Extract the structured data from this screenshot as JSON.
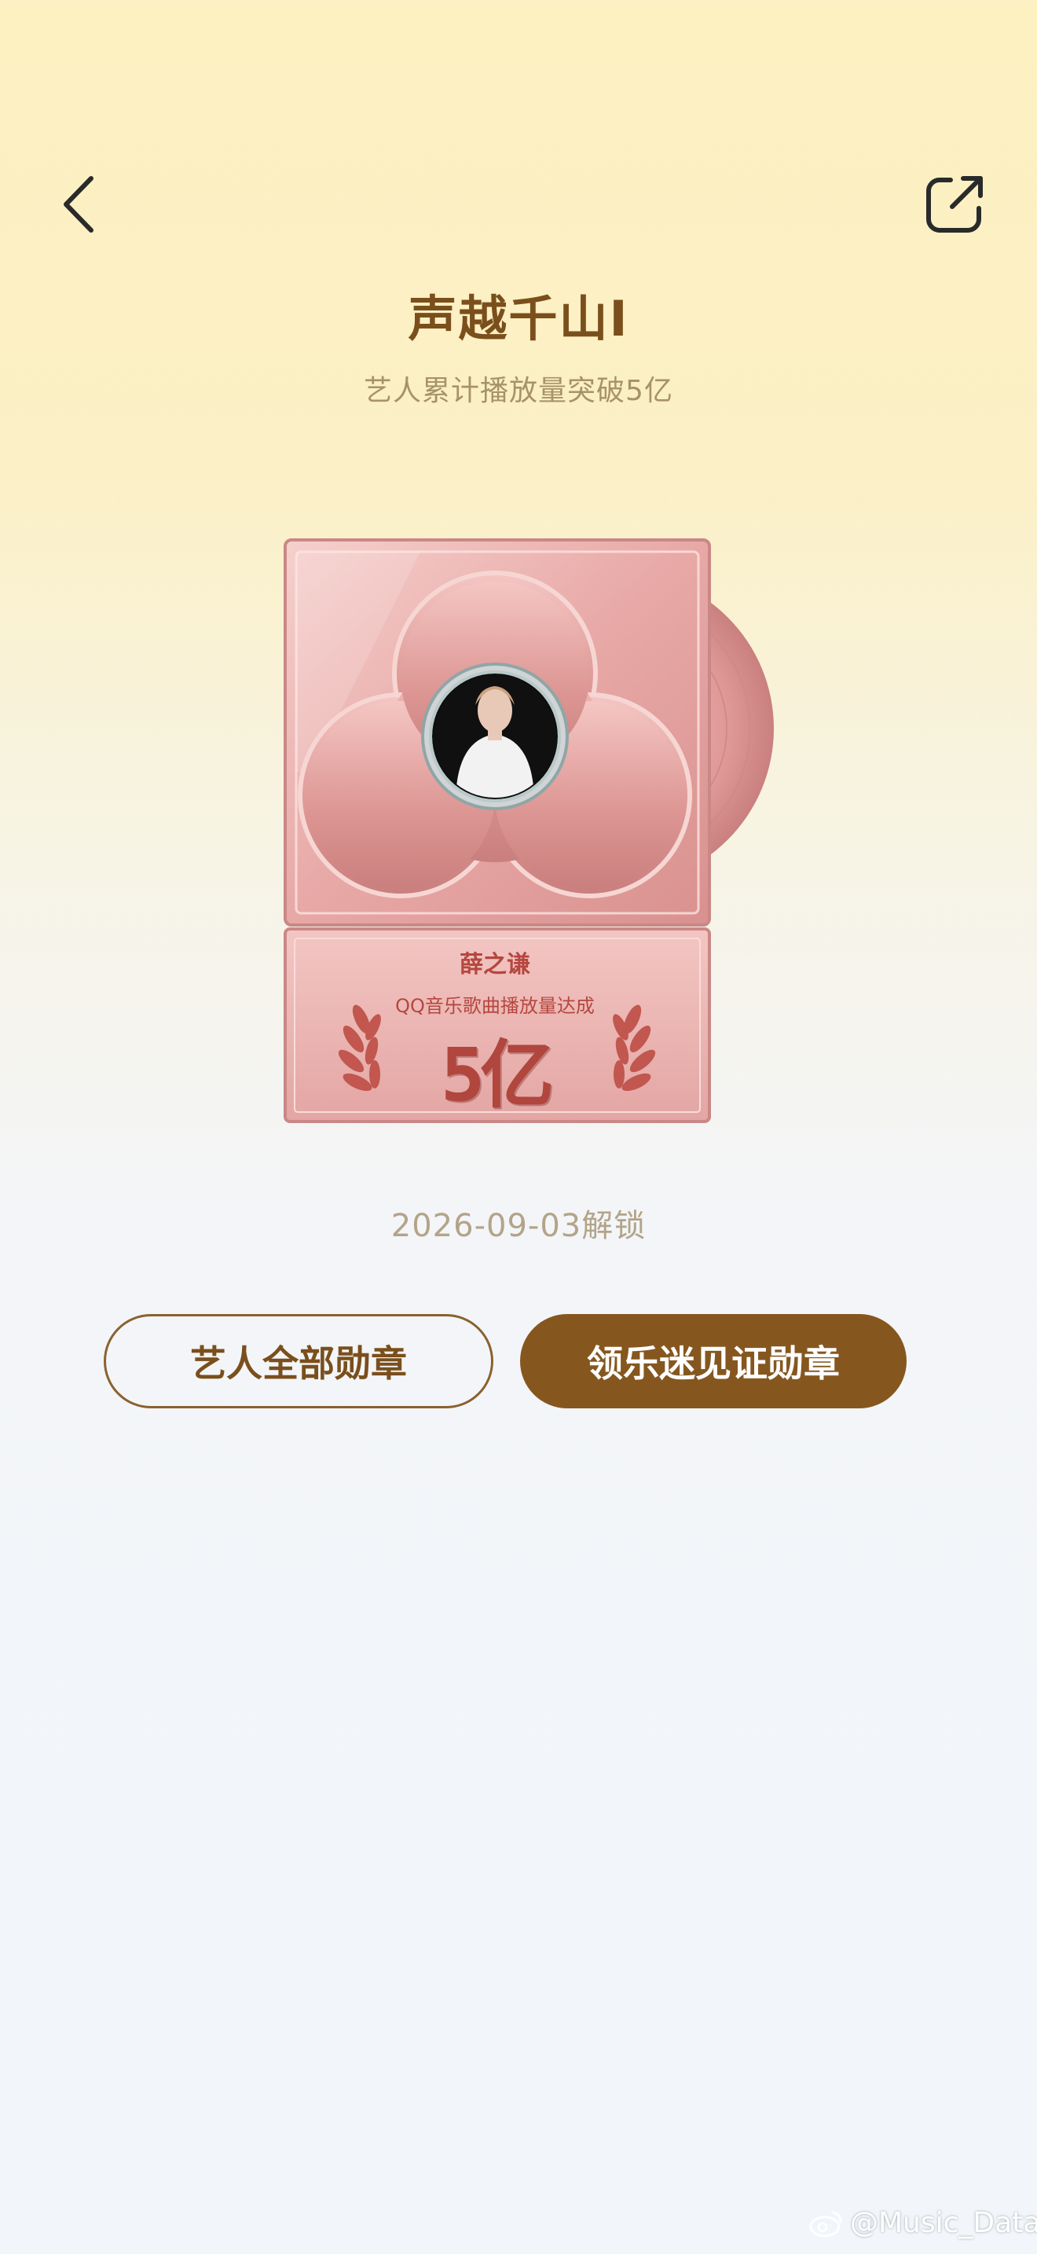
{
  "header": {
    "back_icon": "chevron-left-icon",
    "share_icon": "share-external-icon"
  },
  "medal": {
    "title": "声越千山I",
    "subtitle": "艺人累计播放量突破5亿",
    "artist_name": "薛之谦",
    "caption": "QQ音乐歌曲播放量达成",
    "value": "5亿",
    "unlock_date": "2026-09-03解锁"
  },
  "actions": {
    "all_medals_label": "艺人全部勋章",
    "witness_label": "领乐迷见证勋章"
  },
  "watermark": {
    "text": "@Music_Data",
    "icon": "weibo-icon"
  },
  "colors": {
    "accent_brown": "#85571f",
    "title_brown": "#7a4f1c",
    "badge_pink": "#e4a3a1",
    "badge_text": "#b5473f"
  }
}
